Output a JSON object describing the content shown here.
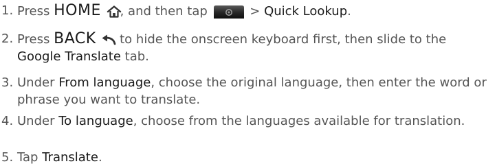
{
  "steps": [
    {
      "num": "1.",
      "pre": "Press ",
      "key": "HOME",
      "mid": ", and then tap ",
      "sep": " > ",
      "target": "Quick Lookup",
      "end": "."
    },
    {
      "num": "2.",
      "pre": "Press ",
      "key": "BACK",
      "mid": " to hide the onscreen keyboard first, then slide to the ",
      "target": "Google Translate",
      "end": " tab."
    },
    {
      "num": "3.",
      "pre": "Under ",
      "target": "From language",
      "end": ", choose the original language, then enter the word or phrase you want to translate."
    },
    {
      "num": "4.",
      "pre": "Under ",
      "target": "To language",
      "end": ", choose from the languages available for translation."
    },
    {
      "num": "5.",
      "pre": "Tap ",
      "target": "Translate",
      "end": "."
    }
  ]
}
